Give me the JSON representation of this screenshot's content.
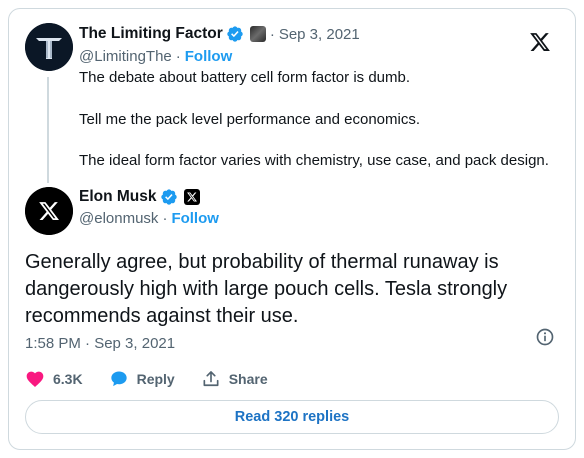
{
  "parent_tweet": {
    "author_name": "The Limiting Factor",
    "handle": "@LimitingThe",
    "follow_label": "Follow",
    "separator": "·",
    "date": "Sep 3, 2021",
    "lines": [
      "The debate about battery cell form factor is dumb.",
      "Tell me the pack level performance and economics.",
      "The ideal form factor varies with chemistry, use case, and pack design."
    ]
  },
  "tweet": {
    "author_name": "Elon Musk",
    "handle": "@elonmusk",
    "follow_label": "Follow",
    "separator": "·",
    "text": "Generally agree, but probability of thermal runaway is dangerously high with large pouch cells. Tesla strongly recommends against their use.",
    "timestamp": "1:58 PM · Sep 3, 2021",
    "likes": "6.3K",
    "reply_label": "Reply",
    "share_label": "Share",
    "read_replies_label": "Read 320 replies"
  },
  "icons": {
    "brand": "x-logo-icon",
    "verified": "verified-badge-icon",
    "like": "heart-icon",
    "reply": "speech-bubble-icon",
    "share": "share-upload-icon",
    "info": "info-icon"
  },
  "colors": {
    "accent": "#1d9bf0",
    "like": "#f91880",
    "text": "#0f1419",
    "muted": "#536471",
    "border": "#cfd9de"
  }
}
